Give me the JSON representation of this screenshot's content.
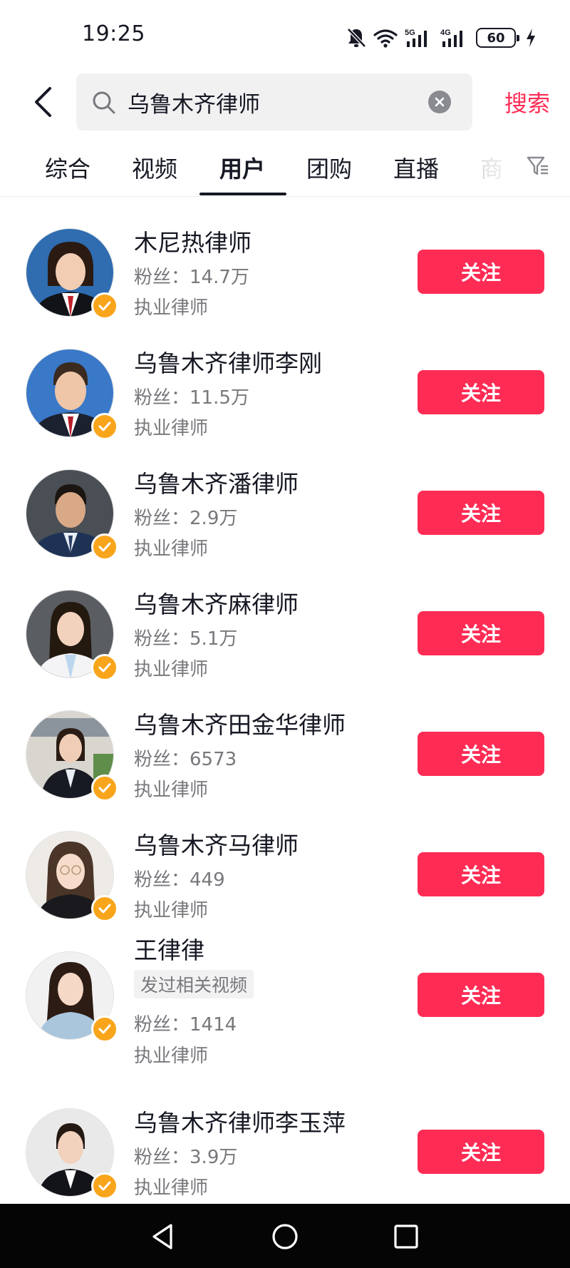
{
  "status_bar": {
    "time": "19:25",
    "battery": "60",
    "icons": [
      "mute-bell-icon",
      "wifi-icon",
      "5g-signal-icon",
      "4g-signal-icon",
      "battery-icon",
      "charging-icon"
    ],
    "net_5g": "5G",
    "net_4g": "4G"
  },
  "search": {
    "query": "乌鲁木齐律师",
    "submit_label": "搜索"
  },
  "tabs": [
    {
      "label": "综合"
    },
    {
      "label": "视频"
    },
    {
      "label": "用户",
      "active": true
    },
    {
      "label": "团购"
    },
    {
      "label": "直播"
    },
    {
      "label": "商"
    }
  ],
  "users": [
    {
      "name": "木尼热律师",
      "fans_label": "粉丝：",
      "fans": "14.7万",
      "title": "执业律师",
      "follow": "关注"
    },
    {
      "name": "乌鲁木齐律师李刚",
      "fans_label": "粉丝：",
      "fans": "11.5万",
      "title": "执业律师",
      "follow": "关注"
    },
    {
      "name": "乌鲁木齐潘律师",
      "fans_label": "粉丝：",
      "fans": "2.9万",
      "title": "执业律师",
      "follow": "关注"
    },
    {
      "name": "乌鲁木齐麻律师",
      "fans_label": "粉丝：",
      "fans": "5.1万",
      "title": "执业律师",
      "follow": "关注"
    },
    {
      "name": "乌鲁木齐田金华律师",
      "fans_label": "粉丝：",
      "fans": "6573",
      "title": "执业律师",
      "follow": "关注"
    },
    {
      "name": "乌鲁木齐马律师",
      "fans_label": "粉丝：",
      "fans": "449",
      "title": "执业律师",
      "follow": "关注"
    },
    {
      "name": "王律律",
      "tag": "发过相关视频",
      "fans_label": "粉丝：",
      "fans": "1414",
      "title": "执业律师",
      "follow": "关注"
    },
    {
      "name": "乌鲁木齐律师李玉萍",
      "fans_label": "粉丝：",
      "fans": "3.9万",
      "title": "执业律师",
      "follow": "关注"
    }
  ],
  "colors": {
    "accent": "#fe2c55",
    "verified": "#f9a51b",
    "text_primary": "#161823",
    "text_secondary": "#77787c"
  }
}
